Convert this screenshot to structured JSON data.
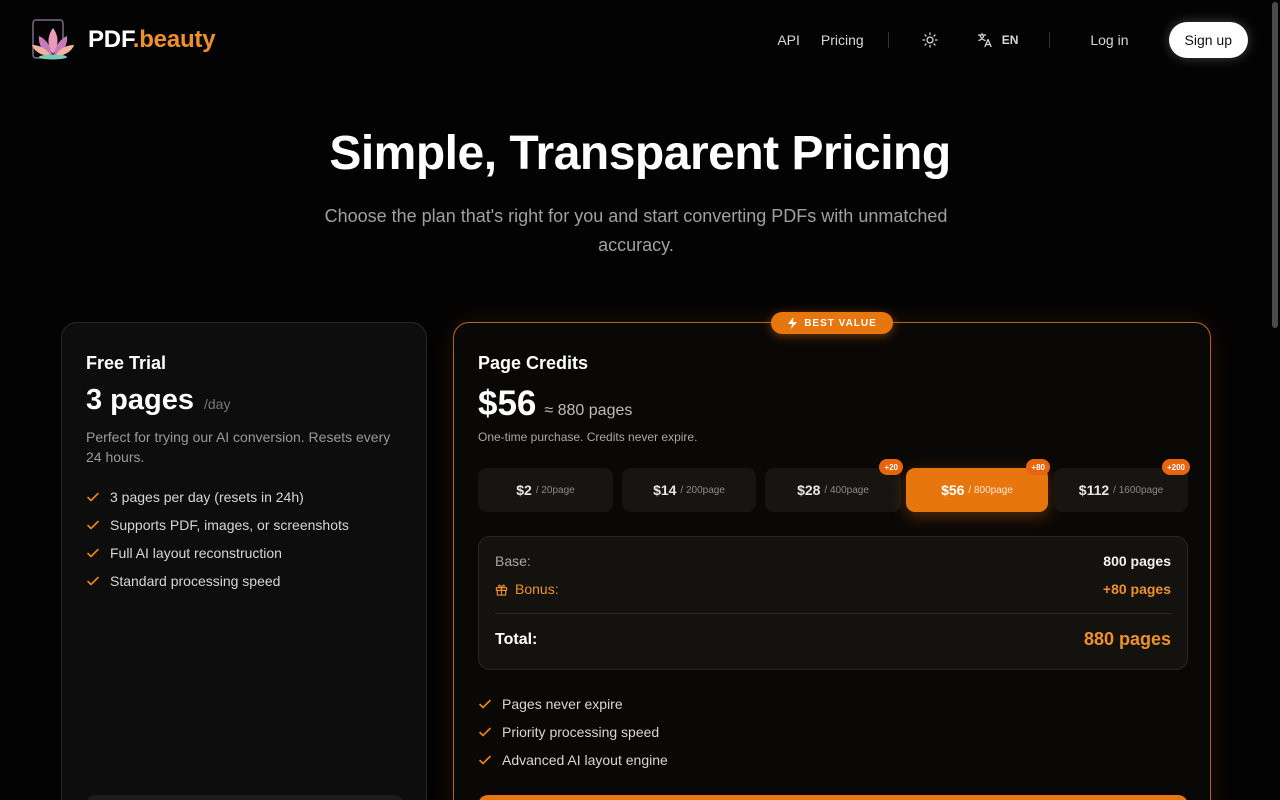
{
  "brand": {
    "name_main": "PDF",
    "name_accent": ".beauty",
    "logo_icon": "lotus-logo-icon"
  },
  "nav": {
    "api": "API",
    "pricing": "Pricing",
    "theme_icon": "sun-icon",
    "language_icon": "translate-icon",
    "language": "EN",
    "login": "Log in",
    "signup": "Sign up"
  },
  "hero": {
    "title": "Simple, Transparent Pricing",
    "subtitle": "Choose the plan that's right for you and start converting PDFs with unmatched accuracy."
  },
  "free_plan": {
    "name": "Free Trial",
    "amount": "3 pages",
    "unit": "/day",
    "description": "Perfect for trying our AI conversion. Resets every 24 hours.",
    "features": [
      "3 pages per day (resets in 24h)",
      "Supports PDF, images, or screenshots",
      "Full AI layout reconstruction",
      "Standard processing speed"
    ]
  },
  "credits_plan": {
    "badge": "BEST VALUE",
    "name": "Page Credits",
    "price": "$56",
    "approx": "≈ 880 pages",
    "note": "One-time purchase. Credits never expire.",
    "tiers": [
      {
        "price": "$2",
        "pages": "/ 20page",
        "bonus": ""
      },
      {
        "price": "$14",
        "pages": "/ 200page",
        "bonus": ""
      },
      {
        "price": "$28",
        "pages": "/ 400page",
        "bonus": "+20"
      },
      {
        "price": "$56",
        "pages": "/ 800page",
        "bonus": "+80",
        "selected": true
      },
      {
        "price": "$112",
        "pages": "/ 1600page",
        "bonus": "+200"
      }
    ],
    "summary": {
      "base_label": "Base:",
      "base_value": "800 pages",
      "bonus_label": "Bonus:",
      "bonus_value": "+80 pages",
      "total_label": "Total:",
      "total_value": "880 pages"
    },
    "features": [
      "Pages never expire",
      "Priority processing speed",
      "Advanced AI layout engine"
    ]
  },
  "colors": {
    "accent": "#e8760e",
    "accent_text": "#f0902a",
    "background": "#030303"
  }
}
